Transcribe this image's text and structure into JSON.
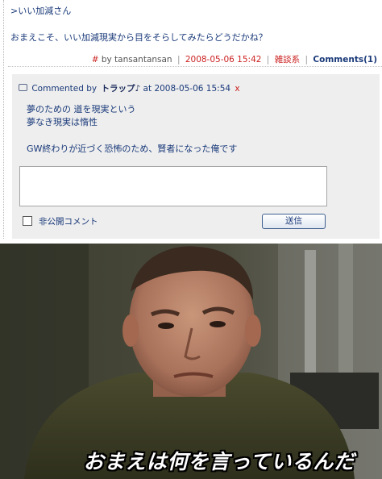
{
  "entry": {
    "quote_line": ">いい加減さん",
    "body_text": "おまえこそ、いい加減現実から目をそらしてみたらどうだかね？",
    "footer": {
      "hash": "#",
      "by_author": "by tansantansan",
      "date": "2008-05-06 15:42",
      "category": "雑談系",
      "comments_link": "Comments(1)"
    }
  },
  "comment": {
    "commented_by_label": "Commented by",
    "author": "トラップ♪",
    "at_label": "at",
    "date": "2008-05-06 15:54",
    "delete_mark": "x",
    "lines": [
      "夢のための 道を現実という",
      "夢なき現実は惰性",
      "GW終わりが近づく恐怖のため、賢者になった俺です"
    ]
  },
  "form": {
    "private_label": "非公開コメント",
    "submit_label": "送信",
    "textarea_value": ""
  },
  "photo": {
    "caption": "おまえは何を言っているんだ"
  },
  "colors": {
    "link_blue": "#1a3a7a",
    "accent_red": "#cc2222",
    "comment_bg": "#eeeeee"
  }
}
